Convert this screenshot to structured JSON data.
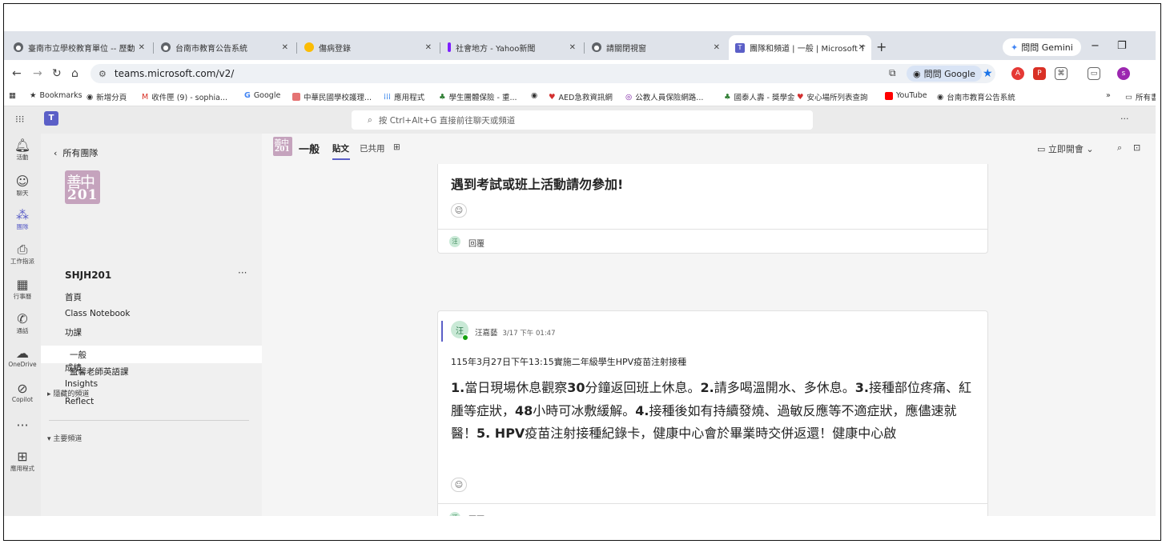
{
  "browser": {
    "tabs": [
      {
        "label": "臺南市立學校教育單位 -- 歷動"
      },
      {
        "label": "台南市教育公告系統"
      },
      {
        "label": "傷病登錄"
      },
      {
        "label": "社會地方 - Yahoo新聞"
      },
      {
        "label": "請關閉視窗"
      },
      {
        "label": "團隊和頻道 | 一般 | Microsoft T"
      }
    ],
    "new_tab": "+",
    "gemini": "問問 Gemini",
    "url": "teams.microsoft.com/v2/",
    "ask_google": "問問 Google",
    "bookmarks": [
      {
        "label": "Bookmarks"
      },
      {
        "label": "新增分頁"
      },
      {
        "label": "收件匣 (9) - sophia..."
      },
      {
        "label": "Google"
      },
      {
        "label": "中華民國學校護理..."
      },
      {
        "label": "應用程式"
      },
      {
        "label": "學生團體保險 - 重..."
      },
      {
        "label": ""
      },
      {
        "label": "AED急救資訊網"
      },
      {
        "label": "公教人員保險網路..."
      },
      {
        "label": "國泰人壽 - 獎學金"
      },
      {
        "label": "安心場所列表查詢"
      },
      {
        "label": "YouTube"
      },
      {
        "label": "台南市教育公告系統"
      }
    ],
    "all_bookmarks": "所有書",
    "colors": {
      "tabstrip": "#dfe3ea",
      "teams_accent": "#5b5fc7"
    }
  },
  "teams": {
    "search_placeholder": "按 Ctrl+Alt+G 直接前往聊天或頻道",
    "rail": [
      {
        "icon": "bell-icon",
        "label": "活動"
      },
      {
        "icon": "chat-icon",
        "label": "聊天"
      },
      {
        "icon": "teams-icon",
        "label": "團隊"
      },
      {
        "icon": "assignments-icon",
        "label": "工作指派"
      },
      {
        "icon": "calendar-icon",
        "label": "行事曆"
      },
      {
        "icon": "phone-icon",
        "label": "通話"
      },
      {
        "icon": "onedrive-icon",
        "label": "OneDrive"
      },
      {
        "icon": "copilot-icon",
        "label": "Copilot"
      },
      {
        "icon": "more-icon",
        "label": ""
      },
      {
        "icon": "add-apps-icon",
        "label": "應用程式"
      }
    ],
    "panel": {
      "back_label": "所有團隊",
      "logo_line1": "善中",
      "logo_line2": "201",
      "team_name": "SHJH201",
      "nav": [
        "首頁",
        "Class Notebook",
        "功課",
        "作業",
        "成績",
        "Insights",
        "Reflect"
      ],
      "main_channels_header": "主要頻道",
      "channels": [
        "一般",
        "盈馨老師英語課"
      ],
      "hidden_channels_header": "隱藏的頻道"
    },
    "channel": {
      "logo_line1": "善中",
      "logo_line2": "201",
      "title": "一般",
      "tabs": [
        "貼文",
        "已共用"
      ],
      "meet_now": "立即開會"
    },
    "posts": [
      {
        "body_partial": "遇到考試或班上活動請勿參加!",
        "reply_avatar": "汪",
        "reply_label": "回覆"
      },
      {
        "avatar": "汪",
        "author": "汪嘉藝",
        "time": "3/17 下午 01:47",
        "subject": "115年3月27日下午13:15實施二年級學生HPV疫苗注射接種",
        "body_segments": [
          {
            "b": true,
            "t": "1."
          },
          {
            "b": false,
            "t": "當日現場休息觀察"
          },
          {
            "b": true,
            "t": "30"
          },
          {
            "b": false,
            "t": "分鐘返回班上休息。"
          },
          {
            "b": true,
            "t": "2."
          },
          {
            "b": false,
            "t": "請多喝溫開水、多休息。"
          },
          {
            "b": true,
            "t": "3."
          },
          {
            "b": false,
            "t": "接種部位疼痛、紅腫等症狀，"
          },
          {
            "b": true,
            "t": "48"
          },
          {
            "b": false,
            "t": "小時可冰敷緩解。"
          },
          {
            "b": true,
            "t": "4."
          },
          {
            "b": false,
            "t": "接種後如有持續發燒、過敏反應等不適症狀，應儘速就醫！"
          },
          {
            "b": true,
            "t": "5. HPV"
          },
          {
            "b": false,
            "t": "疫苗注射接種紀錄卡，健康中心會於畢業時交併返還！健康中心啟"
          }
        ],
        "reply_avatar": "汪",
        "reply_label": "回覆"
      }
    ]
  }
}
